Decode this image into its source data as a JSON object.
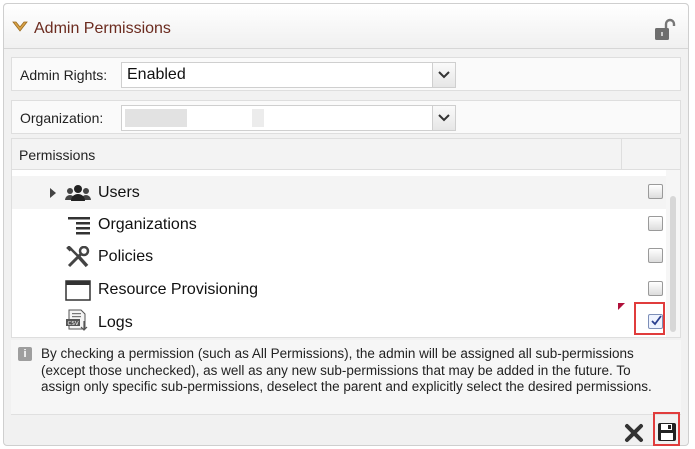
{
  "header": {
    "title": "Admin Permissions"
  },
  "admin_rights": {
    "label": "Admin Rights:",
    "value": "Enabled"
  },
  "organization": {
    "label": "Organization:",
    "value": ""
  },
  "permissions": {
    "header": "Permissions",
    "items": [
      {
        "label": "Users",
        "checked": false,
        "icon": "users-icon"
      },
      {
        "label": "Organizations",
        "checked": false,
        "icon": "organizations-icon"
      },
      {
        "label": "Policies",
        "checked": false,
        "icon": "policies-icon"
      },
      {
        "label": "Resource Provisioning",
        "checked": false,
        "icon": "resource-provisioning-icon"
      },
      {
        "label": "Logs",
        "checked": true,
        "icon": "logs-csv-icon"
      }
    ]
  },
  "info_text": "By checking a permission (such as All Permissions), the admin will be assigned all sub-permissions (except those unchecked), as well as any new sub-permissions that may be added in the future. To assign only specific sub-permissions, deselect the parent and explicitly select the desired permissions.",
  "icons": {
    "csv_label": "CSV"
  },
  "colors": {
    "title": "#6b2b1f",
    "highlight": "#e03c3c",
    "check": "#2a3f8f"
  }
}
